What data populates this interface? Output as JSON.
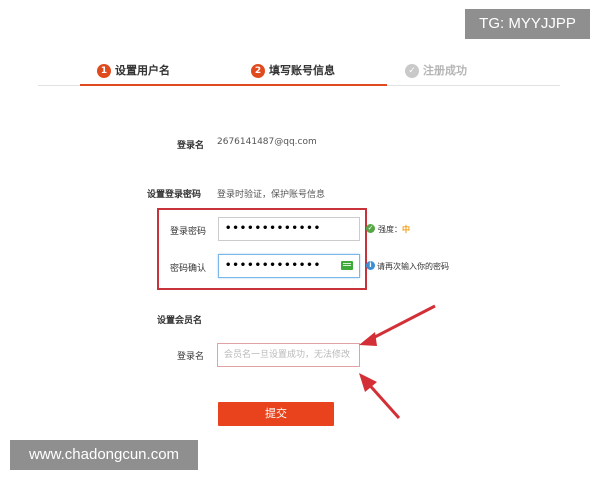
{
  "watermark_top": "TG: MYYJJPP",
  "watermark_bottom": "www.chadongcun.com",
  "steps": [
    {
      "num": "1",
      "label": "设置用户名"
    },
    {
      "num": "2",
      "label": "填写账号信息"
    },
    {
      "num": "✓",
      "label": "注册成功"
    }
  ],
  "login_name": {
    "label": "登录名",
    "value": "2676141487@qq.com"
  },
  "password_section": {
    "title": "设置登录密码",
    "hint": "登录时验证，保护账号信息"
  },
  "password": {
    "label": "登录密码",
    "value": "•••••••••••••",
    "strength_label": "强度：",
    "strength_value": "中"
  },
  "confirm": {
    "label": "密码确认",
    "value": "•••••••••••••",
    "hint": "请再次输入你的密码"
  },
  "member_section": {
    "title": "设置会员名"
  },
  "member": {
    "label": "登录名",
    "placeholder": "会员名一旦设置成功，无法修改"
  },
  "submit_label": "提交",
  "colors": {
    "accent": "#e04a1f",
    "highlight": "#c8323a",
    "watermark_bg": "#8f8f8f",
    "focus": "#7cb8e6"
  },
  "icons": [
    "check-circle-icon",
    "info-icon",
    "keyboard-icon",
    "arrow-icon"
  ]
}
